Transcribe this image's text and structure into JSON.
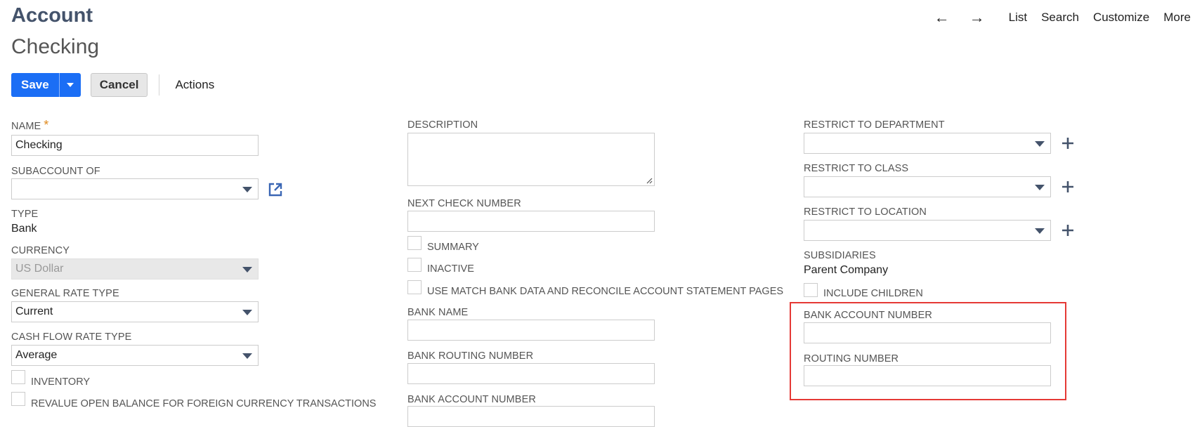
{
  "header": {
    "title": "Account",
    "record_name": "Checking",
    "nav": {
      "back_icon": "left-arrow-icon",
      "forward_icon": "right-arrow-icon",
      "links": [
        "List",
        "Search",
        "Customize",
        "More"
      ]
    }
  },
  "toolbar": {
    "save_label": "Save",
    "cancel_label": "Cancel",
    "actions_label": "Actions"
  },
  "colors": {
    "accent": "#1b6ef5",
    "title": "#44536b",
    "required": "#e08a1e",
    "highlight": "#e53935"
  },
  "left_column": {
    "name_label": "NAME",
    "name_required": "*",
    "name_value": "Checking",
    "subaccount_label": "SUBACCOUNT OF",
    "subaccount_value": "",
    "type_label": "TYPE",
    "type_value": "Bank",
    "currency_label": "CURRENCY",
    "currency_value": "US Dollar",
    "general_rate_label": "GENERAL RATE TYPE",
    "general_rate_value": "Current",
    "cash_flow_label": "CASH FLOW RATE TYPE",
    "cash_flow_value": "Average",
    "inventory_label": "INVENTORY",
    "revalue_label": "REVALUE OPEN BALANCE FOR FOREIGN CURRENCY TRANSACTIONS"
  },
  "middle_column": {
    "description_label": "DESCRIPTION",
    "description_value": "",
    "next_check_label": "NEXT CHECK NUMBER",
    "next_check_value": "",
    "summary_label": "SUMMARY",
    "inactive_label": "INACTIVE",
    "match_bank_label": "USE MATCH BANK DATA AND RECONCILE ACCOUNT STATEMENT PAGES",
    "bank_name_label": "BANK NAME",
    "bank_name_value": "",
    "bank_routing_label": "BANK ROUTING NUMBER",
    "bank_routing_value": "",
    "bank_account_label": "BANK ACCOUNT NUMBER",
    "bank_account_value": ""
  },
  "right_column": {
    "restrict_department_label": "RESTRICT TO DEPARTMENT",
    "restrict_class_label": "RESTRICT TO CLASS",
    "restrict_location_label": "RESTRICT TO LOCATION",
    "subsidiaries_label": "SUBSIDIARIES",
    "subsidiaries_value": "Parent Company",
    "include_children_label": "INCLUDE CHILDREN",
    "bank_account_number_label": "BANK ACCOUNT NUMBER",
    "bank_account_number_value": "",
    "routing_number_label": "ROUTING NUMBER",
    "routing_number_value": ""
  }
}
